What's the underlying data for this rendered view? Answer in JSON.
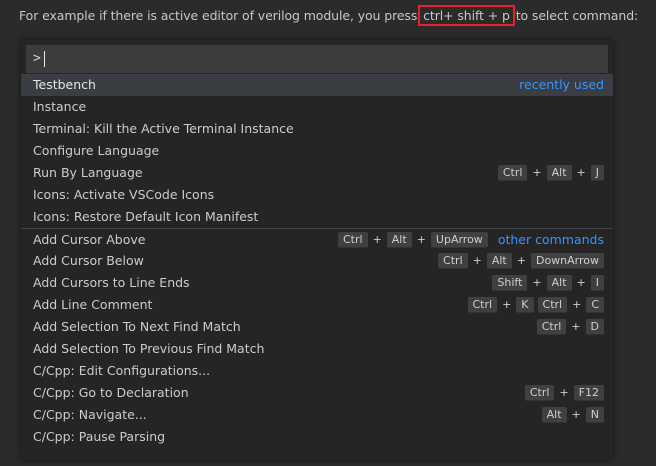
{
  "intro": {
    "before": "For example if there is active editor of verilog module, you press ",
    "highlight": "ctrl+ shift + p",
    "after": " to select command:"
  },
  "palette": {
    "input_value": ">",
    "items": [
      {
        "label": "Testbench",
        "group": "recently used",
        "keys": []
      },
      {
        "label": "Instance",
        "group": "",
        "keys": []
      },
      {
        "label": "Terminal: Kill the Active Terminal Instance",
        "group": "",
        "keys": []
      },
      {
        "label": "Configure Language",
        "group": "",
        "keys": []
      },
      {
        "label": "Run By Language",
        "group": "",
        "keys": [
          "Ctrl",
          "Alt",
          "J"
        ]
      },
      {
        "label": "Icons: Activate VSCode Icons",
        "group": "",
        "keys": []
      },
      {
        "label": "Icons: Restore Default Icon Manifest",
        "group": "",
        "keys": []
      },
      {
        "label": "Add Cursor Above",
        "group": "other commands",
        "keys": [
          "Ctrl",
          "Alt",
          "UpArrow"
        ]
      },
      {
        "label": "Add Cursor Below",
        "group": "",
        "keys": [
          "Ctrl",
          "Alt",
          "DownArrow"
        ]
      },
      {
        "label": "Add Cursors to Line Ends",
        "group": "",
        "keys": [
          "Shift",
          "Alt",
          "I"
        ]
      },
      {
        "label": "Add Line Comment",
        "group": "",
        "chords": [
          [
            "Ctrl",
            "K"
          ],
          [
            "Ctrl",
            "C"
          ]
        ]
      },
      {
        "label": "Add Selection To Next Find Match",
        "group": "",
        "keys": [
          "Ctrl",
          "D"
        ]
      },
      {
        "label": "Add Selection To Previous Find Match",
        "group": "",
        "keys": []
      },
      {
        "label": "C/Cpp: Edit Configurations...",
        "group": "",
        "keys": []
      },
      {
        "label": "C/Cpp: Go to Declaration",
        "group": "",
        "keys": [
          "Ctrl",
          "F12"
        ]
      },
      {
        "label": "C/Cpp: Navigate...",
        "group": "",
        "keys": [
          "Alt",
          "N"
        ]
      },
      {
        "label": "C/Cpp: Pause Parsing",
        "group": "",
        "keys": []
      }
    ]
  },
  "colors": {
    "group_label": "#3794ff",
    "highlight_box": "#e8222b",
    "selected_row": "#3a3d41"
  }
}
